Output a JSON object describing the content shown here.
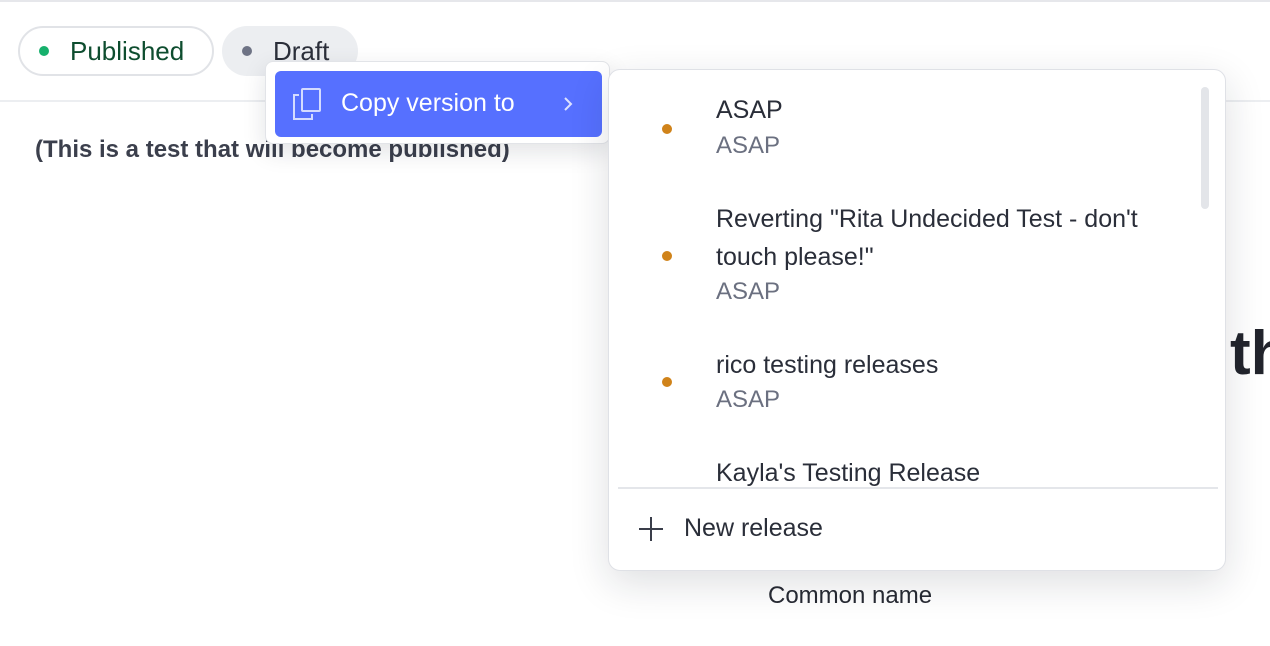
{
  "tabs": {
    "published_label": "Published",
    "draft_label": "Draft"
  },
  "document": {
    "body_text": "(This is a test that will become published)",
    "heading_fragment": "th",
    "field_label": "Common name"
  },
  "context_menu": {
    "copy_version_label": "Copy version to"
  },
  "releases_menu": {
    "items": [
      {
        "title": "ASAP",
        "subtitle": "ASAP"
      },
      {
        "title": "Reverting \"Rita Undecided Test - don't touch please!\"",
        "subtitle": "ASAP"
      },
      {
        "title": "rico testing releases",
        "subtitle": "ASAP"
      },
      {
        "title": "Kayla's Testing Release",
        "subtitle": ""
      }
    ],
    "new_release_label": "New release"
  },
  "colors": {
    "accent": "#5670ff",
    "published_dot": "#16b06c",
    "release_dot": "#d0831a"
  },
  "icons": {
    "copy": "copy-icon",
    "chevron": "chevron-right-icon",
    "plus": "plus-icon"
  }
}
